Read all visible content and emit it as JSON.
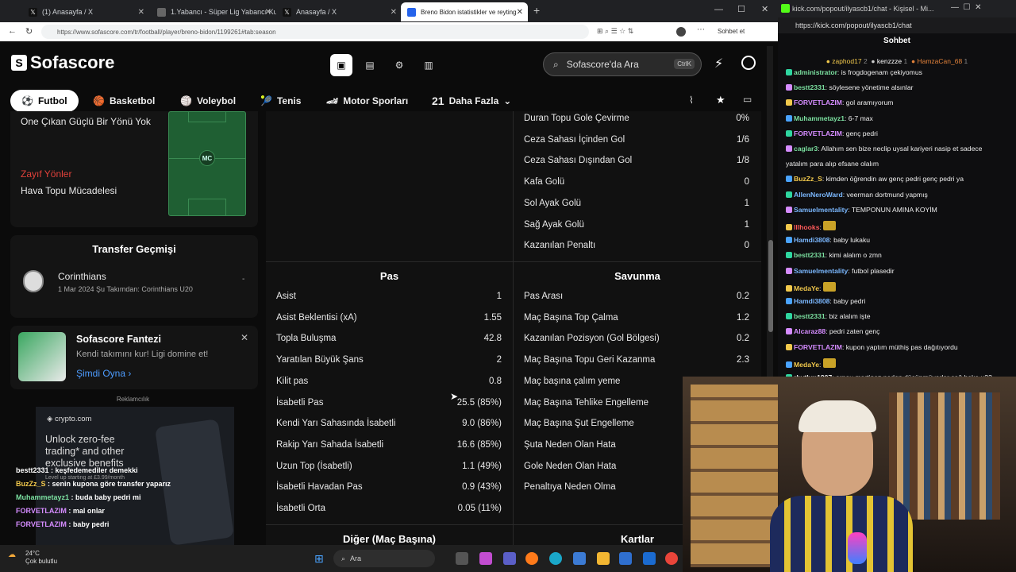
{
  "browser": {
    "tabs": [
      {
        "label": "(1) Anasayfa / X",
        "icon": "x-logo-icon"
      },
      {
        "label": "1.Yabancı - Süper Lig Yabancı Kur...",
        "icon": "page-icon"
      },
      {
        "label": "Anasayfa / X",
        "icon": "x-logo-icon"
      },
      {
        "label": "Breno Bidon istatistikler ve reyting",
        "icon": "sofascore-icon"
      }
    ],
    "url": "https://www.sofascore.com/tr/football/player/breno-bidon/1199261#tab:season",
    "profile_label": "Sohbet et"
  },
  "sofascore": {
    "logo_text": "Sofascore",
    "search_placeholder": "Sofascore'da Ara",
    "search_shortcut": "CtrlK",
    "sports": [
      "Futbol",
      "Basketbol",
      "Voleybol",
      "Tenis",
      "Motor Sporları",
      "Daha Fazla"
    ],
    "more_count": "21"
  },
  "left": {
    "strong_label": "One Çıkan Güçlü Bir Yönü Yok",
    "weak_title": "Zayıf Yönler",
    "weak_item": "Hava Topu Mücadelesi",
    "position_badge": "MC",
    "transfer_title": "Transfer Geçmişi",
    "transfer_club": "Corinthians",
    "transfer_detail": "1 Mar 2024 Şu Takımdan: Corinthians U20",
    "transfer_dash": "-",
    "fantasy_title": "Sofascore Fantezi",
    "fantasy_text": "Kendi takımını kur! Ligi domine et!",
    "fantasy_cta": "Şimdi Oyna",
    "ad_label": "Reklamcılık",
    "ad_brand": "crypto.com",
    "ad_line1": "Unlock zero-fee",
    "ad_line2": "trading* and other",
    "ad_line3": "exclusive benefits",
    "ad_small": "Level up starting at £3.99/month"
  },
  "overlay_chat": [
    {
      "user": "bestt2331",
      "text": "keşfedemediler demekki",
      "color": "#ffffff"
    },
    {
      "user": "BuzZz_S",
      "text": "senin kupona göre transfer yaparız",
      "color": "#f2c94c"
    },
    {
      "user": "Muhammetayz1",
      "text": "buda baby pedri mi",
      "color": "#7be0a0"
    },
    {
      "user": "FORVETLAZIM",
      "text": "mal onlar",
      "color": "#d58cff"
    },
    {
      "user": "FORVETLAZIM",
      "text": "baby pedri",
      "color": "#d58cff"
    }
  ],
  "stats": {
    "goals_rows": [
      {
        "label": "Duran Topu Gole Çevirme",
        "value": "0%"
      },
      {
        "label": "Ceza Sahası İçinden Gol",
        "value": "1/6"
      },
      {
        "label": "Ceza Sahası Dışından Gol",
        "value": "1/8"
      },
      {
        "label": "Kafa Golü",
        "value": "0"
      },
      {
        "label": "Sol Ayak Golü",
        "value": "1"
      },
      {
        "label": "Sağ Ayak Golü",
        "value": "1"
      },
      {
        "label": "Kazanılan Penaltı",
        "value": "0"
      }
    ],
    "pass_title": "Pas",
    "pass_rows": [
      {
        "label": "Asist",
        "value": "1"
      },
      {
        "label": "Asist Beklentisi (xA)",
        "value": "1.55"
      },
      {
        "label": "Topla Buluşma",
        "value": "42.8"
      },
      {
        "label": "Yaratılan Büyük Şans",
        "value": "2"
      },
      {
        "label": "Kilit pas",
        "value": "0.8"
      },
      {
        "label": "İsabetli Pas",
        "value": "25.5 (85%)"
      },
      {
        "label": "Kendi Yarı Sahasında İsabetli",
        "value": "9.0 (86%)"
      },
      {
        "label": "Rakip Yarı Sahada İsabetli",
        "value": "16.6 (85%)"
      },
      {
        "label": "Uzun Top (İsabetli)",
        "value": "1.1 (49%)"
      },
      {
        "label": "İsabetli Havadan Pas",
        "value": "0.9 (43%)"
      },
      {
        "label": "İsabetli Orta",
        "value": "0.05 (11%)"
      }
    ],
    "defense_title": "Savunma",
    "defense_rows": [
      {
        "label": "Pas Arası",
        "value": "0.2"
      },
      {
        "label": "Maç Başına Top Çalma",
        "value": "1.2"
      },
      {
        "label": "Kazanılan Pozisyon (Gol Bölgesi)",
        "value": "0.2"
      },
      {
        "label": "Maç Başına Topu Geri Kazanma",
        "value": "2.3"
      },
      {
        "label": "Maç başına çalım yeme",
        "value": ""
      },
      {
        "label": "Maç Başına Tehlike Engelleme",
        "value": ""
      },
      {
        "label": "Maç Başına Şut Engelleme",
        "value": ""
      },
      {
        "label": "Şuta Neden Olan Hata",
        "value": ""
      },
      {
        "label": "Gole Neden Olan Hata",
        "value": ""
      },
      {
        "label": "Penaltıya Neden Olma",
        "value": ""
      }
    ],
    "other_title": "Diğer (Maç Başına)",
    "cards_title": "Kartlar"
  },
  "kick": {
    "window_title": "kick.com/popout/ilyascb1/chat - Kişisel - Mi...",
    "url": "https://kick.com/popout/ilyascb1/chat",
    "chat_title": "Sohbet",
    "top_gifters": [
      {
        "user": "zaphod17",
        "count": "2"
      },
      {
        "user": "kenzzze",
        "count": "1"
      },
      {
        "user": "HamzaCan_68",
        "count": "1"
      }
    ],
    "messages": [
      {
        "user": "administrator",
        "text": "is frogdogenam çekiyomus",
        "color": "#7be0a0"
      },
      {
        "user": "bestt2331",
        "text": "söylesene yönetime alsınlar",
        "color": "#7be0a0"
      },
      {
        "user": "FORVETLAZIM",
        "text": "gol aramıyorum",
        "color": "#d58cff"
      },
      {
        "user": "Muhammetayz1",
        "text": "6-7 max",
        "color": "#7be0a0"
      },
      {
        "user": "FORVETLAZIM",
        "text": "genç pedri",
        "color": "#d58cff"
      },
      {
        "user": "caglar3",
        "text": "Allahım sen bize neclip uysal kariyeri nasip et sadece",
        "color": "#7be0a0"
      },
      {
        "user": "",
        "text": "yatalım para alıp efsane olalım",
        "color": "#eeeeee"
      },
      {
        "user": "BuzZz_S",
        "text": "kimden öğrendin aw genç pedri genç pedri ya",
        "color": "#f2c94c"
      },
      {
        "user": "AllenNeroWard",
        "text": "veerman dortmund yapmış",
        "color": "#7bb8ff"
      },
      {
        "user": "Samuelmentality",
        "text": "TEMPONUN AMINA KOYİM",
        "color": "#7bb8ff"
      },
      {
        "user": "lllhooks",
        "text": "",
        "color": "#ff5a5a"
      },
      {
        "user": "Hamdi3808",
        "text": "baby lukaku",
        "color": "#7bb8ff"
      },
      {
        "user": "bestt2331",
        "text": "kimi alalım o zmn",
        "color": "#7be0a0"
      },
      {
        "user": "Samuelmentality",
        "text": "futbol plasedir",
        "color": "#7bb8ff"
      },
      {
        "user": "MedaYe",
        "text": "",
        "color": "#f2c94c"
      },
      {
        "user": "Hamdi3808",
        "text": "baby pedri",
        "color": "#7bb8ff"
      },
      {
        "user": "bestt2331",
        "text": "biz alalım işte",
        "color": "#7be0a0"
      },
      {
        "user": "Alcaraz88",
        "text": "pedri zaten genç",
        "color": "#d58cff"
      },
      {
        "user": "FORVETLAZIM",
        "text": "kupon yaptım müthiş pas dağıtıyordu",
        "color": "#d58cff"
      },
      {
        "user": "MedaYe",
        "text": "",
        "color": "#f2c94c"
      },
      {
        "user": "rbythm1907",
        "text": "arnau martinez neden düşünmüyorlar sağ beke u23",
        "color": "#eeeeee"
      }
    ]
  },
  "taskbar": {
    "weather_temp": "24°C",
    "weather_text": "Çok bulutlu",
    "search_label": "Ara"
  }
}
